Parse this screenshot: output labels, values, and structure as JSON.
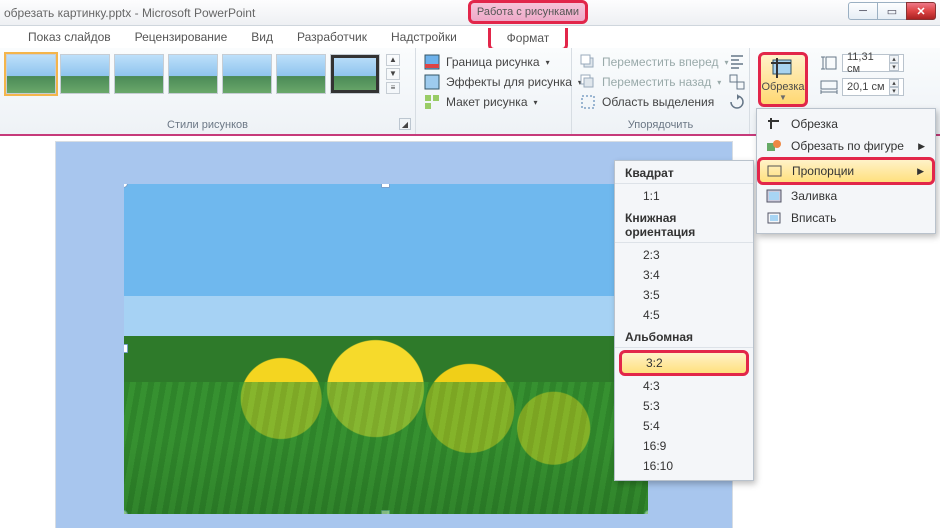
{
  "window": {
    "doc_title": "обрезать картинку.pptx",
    "app": "Microsoft PowerPoint",
    "contextual_tab_group": "Работа с рисунками"
  },
  "tabs": {
    "slideshow": "Показ слайдов",
    "review": "Рецензирование",
    "view": "Вид",
    "developer": "Разработчик",
    "addins": "Надстройки",
    "format": "Формат"
  },
  "ribbon": {
    "picture_styles": {
      "label": "Стили рисунков",
      "border": "Граница рисунка",
      "effects": "Эффекты для рисунка",
      "layout": "Макет рисунка"
    },
    "arrange": {
      "label": "Упорядочить",
      "bring_forward": "Переместить вперед",
      "send_backward": "Переместить назад",
      "selection_pane": "Область выделения"
    },
    "crop": {
      "label": "Обрезка"
    },
    "size": {
      "height": "11,31 см",
      "width": "20,1 см"
    }
  },
  "crop_menu": {
    "crop": "Обрезка",
    "crop_to_shape": "Обрезать по фигуре",
    "aspect": "Пропорции",
    "fill": "Заливка",
    "fit": "Вписать"
  },
  "ratio_menu": {
    "square_h": "Квадрат",
    "square": [
      "1:1"
    ],
    "portrait_h": "Книжная ориентация",
    "portrait": [
      "2:3",
      "3:4",
      "3:5",
      "4:5"
    ],
    "landscape_h": "Альбомная",
    "landscape": [
      "3:2",
      "4:3",
      "5:3",
      "5:4",
      "16:9",
      "16:10"
    ],
    "selected": "3:2"
  }
}
